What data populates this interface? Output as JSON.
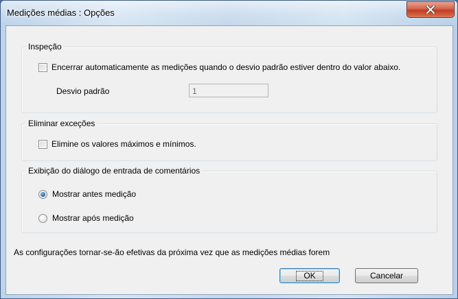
{
  "window": {
    "title": "Medições médias : Opções",
    "close_icon": "close-icon"
  },
  "inspection": {
    "legend": "Inspeção",
    "auto_end_label": "Encerrar automaticamente as medições quando o desvio padrão estiver dentro do valor abaixo.",
    "auto_end_checked": false,
    "std_dev_label": "Desvio padrão",
    "std_dev_value": "1"
  },
  "exceptions": {
    "legend": "Eliminar exceções",
    "eliminate_label": "Elimine os valores máximos e mínimos.",
    "eliminate_checked": false
  },
  "comment_dialog": {
    "legend": "Exibição do diálogo de entrada de comentários",
    "options": [
      {
        "label": "Mostrar antes medição",
        "selected": true
      },
      {
        "label": "Mostrar após medição",
        "selected": false
      }
    ]
  },
  "footer": {
    "note": "As configurações tornar-se-ão efetivas da próxima vez que as medições médias forem",
    "ok_label": "OK",
    "cancel_label": "Cancelar"
  }
}
